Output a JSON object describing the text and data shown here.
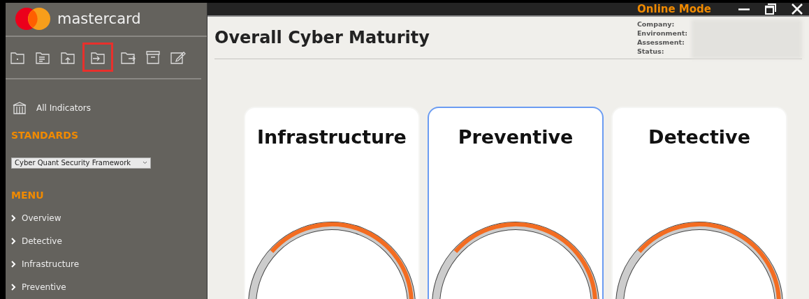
{
  "brand": {
    "name": "mastercard"
  },
  "toolbar": [
    {
      "kind": "folder-plus",
      "highlighted": false
    },
    {
      "kind": "folder-lines",
      "highlighted": false
    },
    {
      "kind": "folder-upload",
      "highlighted": false
    },
    {
      "kind": "folder-import",
      "highlighted": true
    },
    {
      "kind": "folder-export",
      "highlighted": false
    },
    {
      "kind": "archive",
      "highlighted": false
    },
    {
      "kind": "edit",
      "highlighted": false
    }
  ],
  "sidebar": {
    "all_indicators": "All Indicators",
    "standards_heading": "STANDARDS",
    "standard_select": {
      "value": "Cyber Quant Security Framework"
    },
    "menu_heading": "MENU",
    "menu_items": [
      {
        "label": "Overview"
      },
      {
        "label": "Detective"
      },
      {
        "label": "Infrastructure"
      },
      {
        "label": "Preventive"
      }
    ]
  },
  "title_bar": {
    "mode": "Online Mode"
  },
  "header": {
    "title": "Overall Cyber Maturity",
    "info_labels": [
      "Company:",
      "Environment:",
      "Assessment:",
      "Status:"
    ]
  },
  "cards": [
    {
      "title": "Infrastructure",
      "selected": false
    },
    {
      "title": "Preventive",
      "selected": true
    },
    {
      "title": "Detective",
      "selected": false
    }
  ]
}
